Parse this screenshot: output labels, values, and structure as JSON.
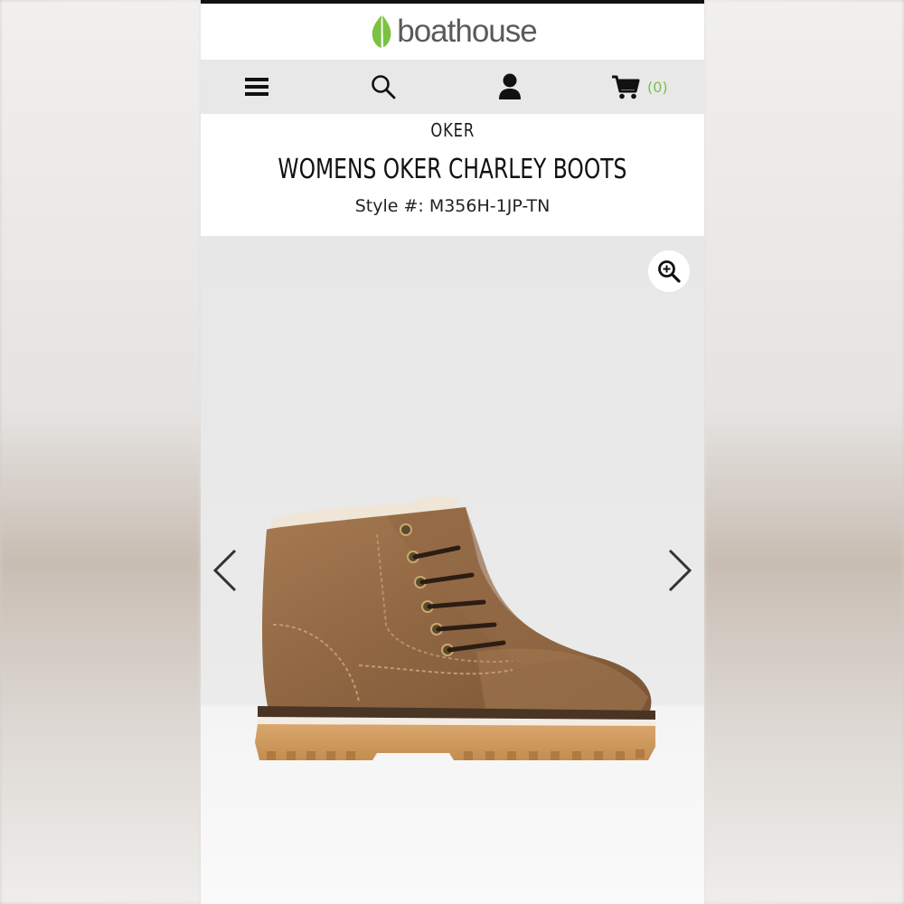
{
  "brand_logo": {
    "text": "boathouse",
    "leaf_color": "#7cc242",
    "text_color": "#5a5a5a"
  },
  "nav": {
    "menu_icon": "hamburger-icon",
    "search_icon": "search-icon",
    "account_icon": "user-icon",
    "cart_icon": "shopping-cart-icon",
    "cart_count": "(0)",
    "accent": "#7cc242"
  },
  "product": {
    "brand": "OKER",
    "title": "WOMENS OKER CHARLEY BOOTS",
    "style": "Style #: M356H-1JP-TN"
  },
  "gallery": {
    "zoom_icon": "zoom-in-icon",
    "prev_icon": "chevron-left-icon",
    "next_icon": "chevron-right-icon"
  }
}
